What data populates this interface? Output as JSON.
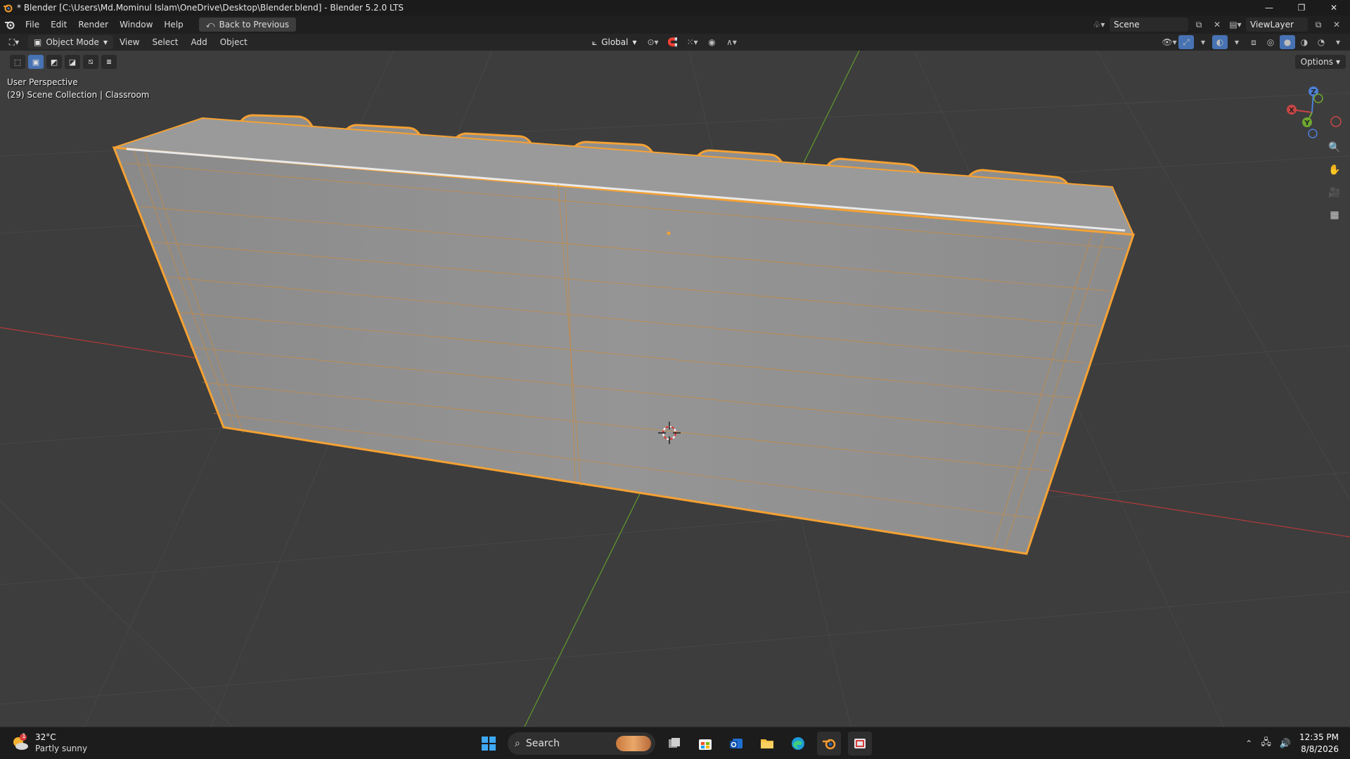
{
  "window": {
    "title": "* Blender [C:\\Users\\Md.Mominul Islam\\OneDrive\\Desktop\\Blender.blend] - Blender 5.2.0 LTS",
    "controls": [
      "minimize-icon",
      "restore-icon",
      "close-icon"
    ]
  },
  "menubar": {
    "items": [
      "File",
      "Edit",
      "Render",
      "Window",
      "Help"
    ],
    "back_button": "Back to Previous",
    "scene": "Scene",
    "view_layer": "ViewLayer"
  },
  "viewport_header": {
    "mode": "Object Mode",
    "menus": [
      "View",
      "Select",
      "Add",
      "Object"
    ],
    "orientation": "Global"
  },
  "viewport": {
    "options_label": "Options",
    "perspective": "User Perspective",
    "collection": "(29) Scene Collection | Classroom",
    "gizmo_axes": [
      "X",
      "Y",
      "Z"
    ],
    "colors": {
      "background": "#3d3d3d",
      "grid": "#4a4a4a",
      "x_axis": "#c03a3a",
      "y_axis": "#6ea632",
      "selection": "#f5a133",
      "mesh_face": "#8f8f8f"
    }
  },
  "taskbar": {
    "weather_temp": "32°C",
    "weather_condition": "Partly sunny",
    "weather_badge": "1",
    "search_label": "Search",
    "time": "12:35 PM",
    "date": "8/8/2026"
  }
}
